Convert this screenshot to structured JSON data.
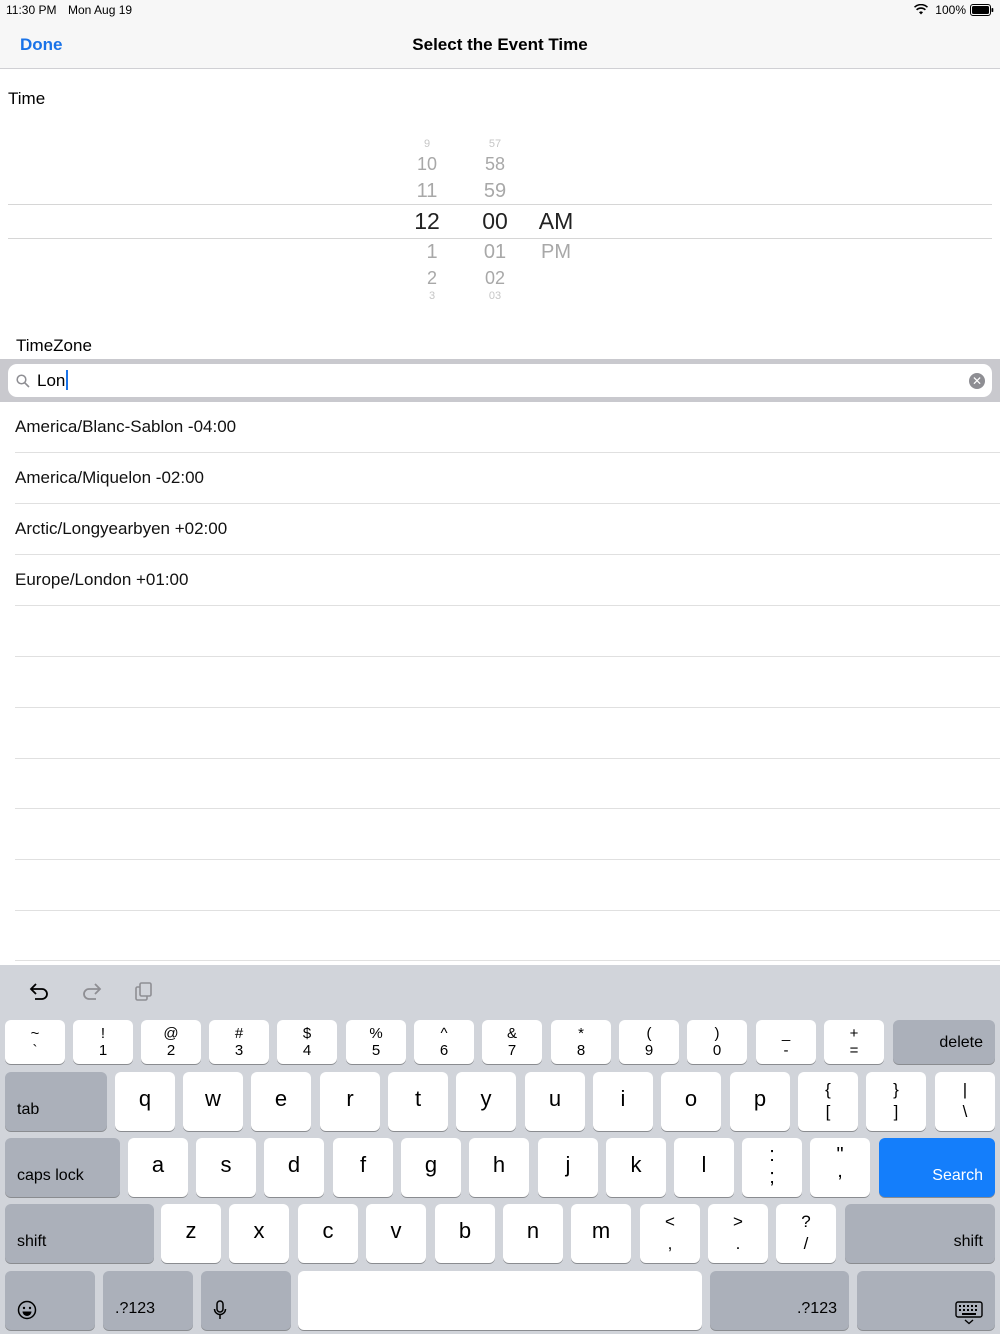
{
  "status_bar": {
    "time": "11:30 PM",
    "date": "Mon Aug 19",
    "battery": "100%"
  },
  "nav": {
    "done": "Done",
    "title": "Select the Event Time"
  },
  "time_section": {
    "label": "Time"
  },
  "picker": {
    "hours": [
      "9",
      "10",
      "11",
      "12",
      "1",
      "2",
      "3"
    ],
    "minutes": [
      "57",
      "58",
      "59",
      "00",
      "01",
      "02",
      "03"
    ],
    "periods": [
      "AM",
      "PM"
    ],
    "selected": {
      "hour": "12",
      "minute": "00",
      "period": "AM"
    }
  },
  "timezone_section": {
    "label": "TimeZone"
  },
  "search": {
    "value": "Lon",
    "clear_icon": "clear-circle-icon"
  },
  "results": [
    {
      "label": "America/Blanc-Sablon -04:00"
    },
    {
      "label": "America/Miquelon -02:00"
    },
    {
      "label": "Arctic/Longyearbyen +02:00"
    },
    {
      "label": "Europe/London +01:00"
    }
  ],
  "keyboard": {
    "row1": [
      {
        "top": "~",
        "bot": "`"
      },
      {
        "top": "!",
        "bot": "1"
      },
      {
        "top": "@",
        "bot": "2"
      },
      {
        "top": "#",
        "bot": "3"
      },
      {
        "top": "$",
        "bot": "4"
      },
      {
        "top": "%",
        "bot": "5"
      },
      {
        "top": "^",
        "bot": "6"
      },
      {
        "top": "&",
        "bot": "7"
      },
      {
        "top": "*",
        "bot": "8"
      },
      {
        "top": "(",
        "bot": "9"
      },
      {
        "top": ")",
        "bot": "0"
      },
      {
        "top": "_",
        "bot": "-"
      },
      {
        "top": "+",
        "bot": "="
      }
    ],
    "delete": "delete",
    "tab": "tab",
    "row2": [
      "q",
      "w",
      "e",
      "r",
      "t",
      "y",
      "u",
      "i",
      "o",
      "p"
    ],
    "row2_sym": [
      {
        "top": "{",
        "bot": "["
      },
      {
        "top": "}",
        "bot": "]"
      },
      {
        "top": "|",
        "bot": "\\"
      }
    ],
    "caps": "caps lock",
    "row3": [
      "a",
      "s",
      "d",
      "f",
      "g",
      "h",
      "j",
      "k",
      "l"
    ],
    "row3_sym": [
      {
        "top": ":",
        "bot": ";"
      },
      {
        "top": "\"",
        "bot": ","
      }
    ],
    "search": "Search",
    "shift": "shift",
    "row4": [
      "z",
      "x",
      "c",
      "v",
      "b",
      "n",
      "m"
    ],
    "row4_sym": [
      {
        "top": "<",
        "bot": ","
      },
      {
        "top": ">",
        "bot": "."
      },
      {
        "top": "?",
        "bot": "/"
      }
    ],
    "num_label": ".?123",
    "accent": "#147efb"
  }
}
